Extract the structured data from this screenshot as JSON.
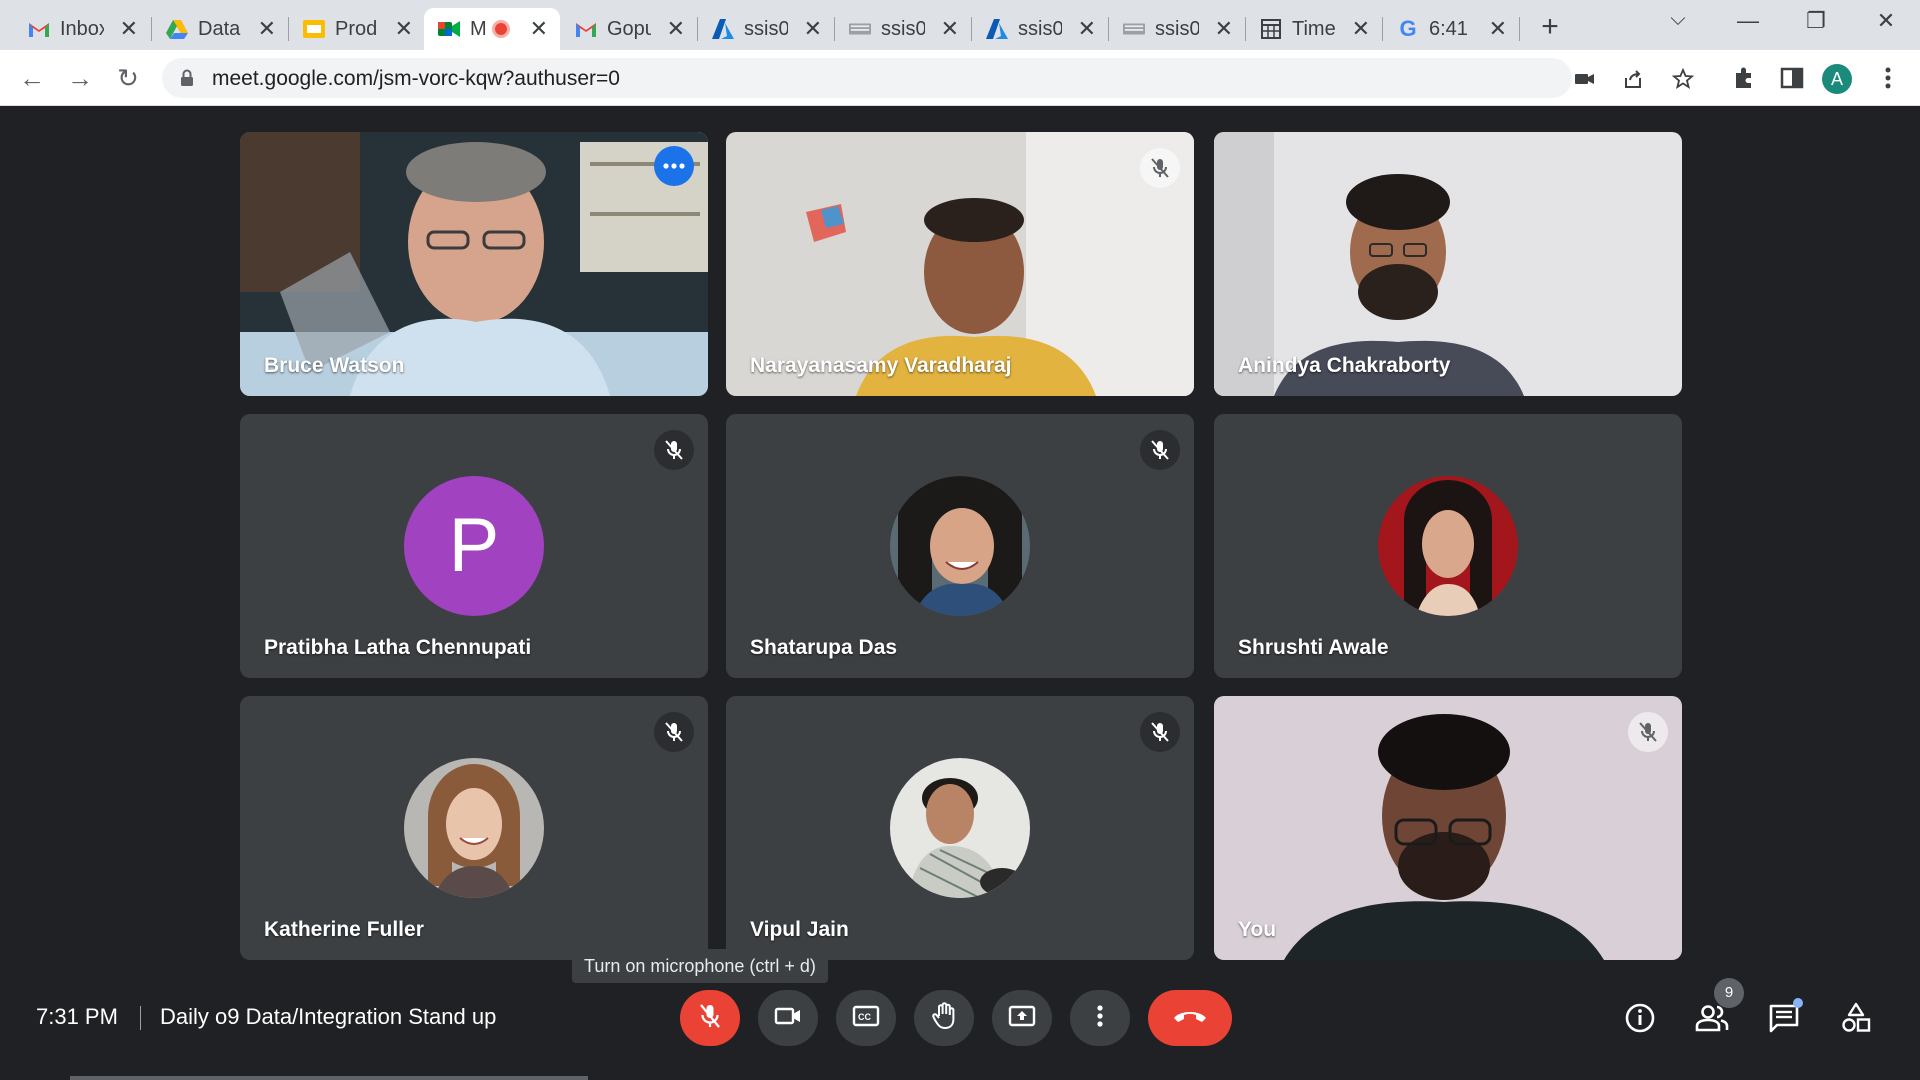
{
  "browser": {
    "tabs": [
      {
        "title": "Inbox",
        "icon": "gmail-icon"
      },
      {
        "title": "Data",
        "icon": "google-drive-icon"
      },
      {
        "title": "Prod",
        "icon": "google-slides-icon"
      },
      {
        "title": "M",
        "icon": "google-meet-icon",
        "recording": true
      },
      {
        "title": "Gopu",
        "icon": "gmail-icon"
      },
      {
        "title": "ssis0",
        "icon": "azure-icon"
      },
      {
        "title": "ssis0",
        "icon": "keyboard-icon"
      },
      {
        "title": "ssis0",
        "icon": "azure-icon"
      },
      {
        "title": "ssis0",
        "icon": "keyboard-icon"
      },
      {
        "title": "Time",
        "icon": "calendar-icon"
      },
      {
        "title": "6:41",
        "icon": "google-icon"
      }
    ],
    "url": "meet.google.com/jsm-vorc-kqw?authuser=0",
    "profile_initial": "A"
  },
  "meeting": {
    "time": "7:31 PM",
    "title": "Daily o9 Data/Integration Stand up",
    "tooltip": "Turn on microphone (ctrl + d)",
    "participant_count": "9",
    "participants": [
      {
        "name": "Bruce Watson",
        "type": "video",
        "muted": false,
        "active": true
      },
      {
        "name": "Narayanasamy Varadharaj",
        "type": "video",
        "muted": true
      },
      {
        "name": "Anindya Chakraborty",
        "type": "video",
        "muted": false
      },
      {
        "name": "Pratibha Latha Chennupati",
        "type": "letter",
        "letter": "P",
        "muted": true
      },
      {
        "name": "Shatarupa Das",
        "type": "photo",
        "muted": true
      },
      {
        "name": "Shrushti Awale",
        "type": "photo",
        "muted": false
      },
      {
        "name": "Katherine Fuller",
        "type": "photo",
        "muted": true
      },
      {
        "name": "Vipul Jain",
        "type": "photo",
        "muted": true
      },
      {
        "name": "You",
        "type": "video",
        "muted": true
      }
    ]
  },
  "colors": {
    "background": "#202124",
    "tile": "#3c4043",
    "danger": "#ea4335",
    "active_outline": "#8ab4f8",
    "avatar_purple": "#a142c1"
  }
}
